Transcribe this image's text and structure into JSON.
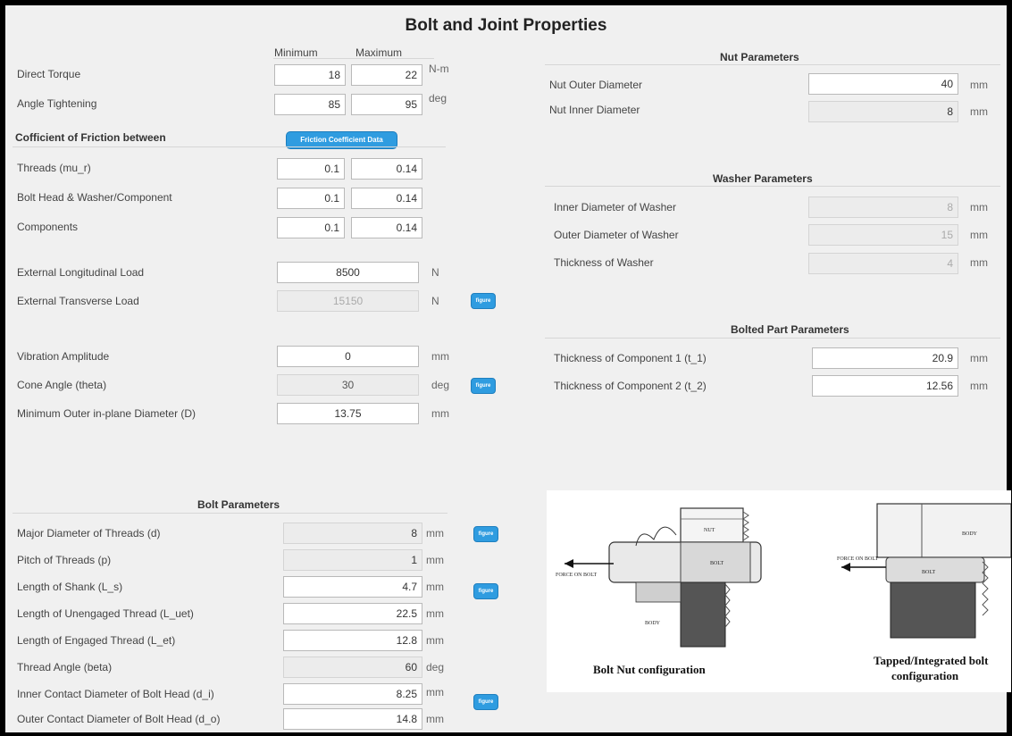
{
  "title": "Bolt and Joint Properties",
  "minmax": {
    "min_label": "Minimum",
    "max_label": "Maximum",
    "direct_torque": {
      "label": "Direct Torque",
      "min": "18",
      "max": "22",
      "unit": "N-m"
    },
    "angle_tightening": {
      "label": "Angle Tightening",
      "min": "85",
      "max": "95",
      "unit": "deg"
    }
  },
  "friction": {
    "heading": "Cofficient of Friction between",
    "button": "Friction Coefficient Data",
    "threads": {
      "label": "Threads (mu_r)",
      "min": "0.1",
      "max": "0.14"
    },
    "bolt_head": {
      "label": "Bolt Head & Washer/Component",
      "min": "0.1",
      "max": "0.14"
    },
    "components": {
      "label": "Components",
      "min": "0.1",
      "max": "0.14"
    }
  },
  "loads": {
    "longitudinal": {
      "label": "External Longitudinal Load",
      "value": "8500",
      "unit": "N"
    },
    "transverse": {
      "label": "External Transverse Load",
      "value": "15150",
      "unit": "N"
    }
  },
  "vibration": {
    "amplitude": {
      "label": "Vibration Amplitude",
      "value": "0",
      "unit": "mm"
    },
    "cone_angle": {
      "label": "Cone Angle (theta)",
      "value": "30",
      "unit": "deg"
    },
    "min_outer": {
      "label": "Minimum Outer in-plane Diameter (D)",
      "value": "13.75",
      "unit": "mm"
    }
  },
  "figure_button": "figure",
  "bolt": {
    "heading": "Bolt Parameters",
    "rows": [
      {
        "label": "Major Diameter of Threads (d)",
        "value": "8",
        "unit": "mm"
      },
      {
        "label": "Pitch of Threads (p)",
        "value": "1",
        "unit": "mm"
      },
      {
        "label": "Length of Shank (L_s)",
        "value": "4.7",
        "unit": "mm"
      },
      {
        "label": "Length of Unengaged Thread (L_uet)",
        "value": "22.5",
        "unit": "mm"
      },
      {
        "label": "Length of Engaged Thread (L_et)",
        "value": "12.8",
        "unit": "mm"
      },
      {
        "label": "Thread Angle (beta)",
        "value": "60",
        "unit": "deg"
      },
      {
        "label": "Inner Contact Diameter of Bolt Head (d_i)",
        "value": "8.25",
        "unit": "mm"
      },
      {
        "label": "Outer Contact Diameter of Bolt Head (d_o)",
        "value": "14.8",
        "unit": "mm"
      }
    ]
  },
  "nut": {
    "heading": "Nut Parameters",
    "outer": {
      "label": "Nut Outer Diameter",
      "value": "40",
      "unit": "mm"
    },
    "inner": {
      "label": "Nut Inner Diameter",
      "value": "8",
      "unit": "mm"
    }
  },
  "washer": {
    "heading": "Washer Parameters",
    "inner": {
      "label": "Inner Diameter of Washer",
      "value": "8",
      "unit": "mm"
    },
    "outer": {
      "label": "Outer Diameter of Washer",
      "value": "15",
      "unit": "mm"
    },
    "thickness": {
      "label": "Thickness of Washer",
      "value": "4",
      "unit": "mm"
    }
  },
  "bolted_part": {
    "heading": "Bolted Part Parameters",
    "t1": {
      "label": "Thickness of Component 1 (t_1)",
      "value": "20.9",
      "unit": "mm"
    },
    "t2": {
      "label": "Thickness of Component 2 (t_2)",
      "value": "12.56",
      "unit": "mm"
    }
  },
  "figure": {
    "left_caption": "Bolt   Nut configuration",
    "right_caption_line1": "Tapped/Integrated bolt",
    "right_caption_line2": "configuration",
    "nut_text": "NUT",
    "bolt_text": "BOLT",
    "body_text": "BODY",
    "force_text": "FORCE ON BOLT"
  },
  "colors": {
    "accent": "#2f9ce0",
    "panel": "#f0f0f0",
    "frame": "#000000"
  }
}
